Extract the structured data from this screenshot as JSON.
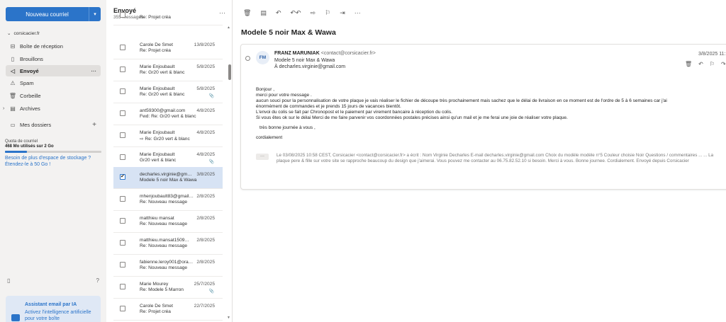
{
  "sidebar": {
    "new_mail_label": "Nouveau courriel",
    "account": "corsicacier.fr",
    "folders": [
      {
        "label": "Boîte de réception",
        "icon": "inbox-icon"
      },
      {
        "label": "Brouillons",
        "icon": "draft-icon"
      },
      {
        "label": "Envoyé",
        "icon": "send-icon",
        "active": true
      },
      {
        "label": "Spam",
        "icon": "spam-icon"
      },
      {
        "label": "Corbeille",
        "icon": "trash-icon"
      },
      {
        "label": "Archives",
        "icon": "archive-icon"
      }
    ],
    "my_folders": "Mes dossiers",
    "quota": {
      "title": "Quota de courriel",
      "used": "468 Mo utilisés sur 2 Go",
      "used_fraction": 0.23,
      "need_more": "Besoin de plus d'espace de stockage ? Étendez-le à 50 Go !"
    },
    "assistant": {
      "title": "Assistant email par IA",
      "desc": "Activez l'intelligence artificielle pour votre boîte"
    }
  },
  "list": {
    "title": "Envoyé",
    "count": "355 messages",
    "items": [
      {
        "from": "",
        "date": "",
        "subject": "Re: Projet créa",
        "selected": false,
        "attachment": false
      },
      {
        "from": "Carole De Smet",
        "date": "13/8/2025",
        "subject": "Re: Projet créa",
        "selected": false,
        "attachment": false
      },
      {
        "from": "Marie Enjoubault",
        "date": "5/8/2025",
        "subject": "Re: Gr20 vert & blanc",
        "selected": false,
        "attachment": false
      },
      {
        "from": "Marie Enjoubault",
        "date": "5/8/2025",
        "subject": "Re: Gr20 vert & blanc",
        "selected": false,
        "attachment": true
      },
      {
        "from": "ant59300@gmail.com",
        "date": "4/8/2025",
        "subject": "Fwd: Re: Gr20 vert & blanc",
        "selected": false,
        "attachment": false
      },
      {
        "from": "Marie Enjoubault",
        "date": "4/8/2025",
        "subject": "⇨ Re: Gr20 vert & blanc",
        "selected": false,
        "attachment": false
      },
      {
        "from": "Marie Enjoubault",
        "date": "4/8/2025",
        "subject": "Gr20 vert & blanc",
        "selected": false,
        "attachment": true
      },
      {
        "from": "decharles.virginie@gmail.com",
        "date": "3/8/2025",
        "subject": "Modele 5 noir Max & Wawa",
        "selected": true,
        "attachment": false
      },
      {
        "from": "mhenjoubault83@gmail.com",
        "date": "2/8/2025",
        "subject": "Re: Nouveau message",
        "selected": false,
        "attachment": false
      },
      {
        "from": "matthieu mansat",
        "date": "2/8/2025",
        "subject": "Re: Nouveau message",
        "selected": false,
        "attachment": false
      },
      {
        "from": "matthieu.mansat1509@gmail.com",
        "date": "2/8/2025",
        "subject": "Re: Nouveau message",
        "selected": false,
        "attachment": false
      },
      {
        "from": "fabienne.leroy001@orange.fr",
        "date": "2/8/2025",
        "subject": "Re: Nouveau message",
        "selected": false,
        "attachment": false
      },
      {
        "from": "Marie Mourey",
        "date": "25/7/2025",
        "subject": "Re: Modele 5 Marron",
        "selected": false,
        "attachment": true
      },
      {
        "from": "Carole De Smet",
        "date": "22/7/2025",
        "subject": "Re: Projet créa",
        "selected": false,
        "attachment": false
      }
    ]
  },
  "reading": {
    "subject": "Modele 5 noir Max & Wawa",
    "sender_name": "FRANZ MARUNIAK",
    "sender_email": "<contact@corsicacier.fr>",
    "avatar": "FM",
    "msg_subject": "Modele 5 noir Max & Wawa",
    "to_prefix": "À",
    "to": "decharles.virginie@gmail.com",
    "date": "3/8/2025 11:",
    "body": [
      "Bonjour ,",
      "merci pour votre message .",
      "aucun souci pour la personnalisation de votre plaque je vais réaliser le fichier de découpe très prochainement mais sachez que le délai de livraison en ce moment est de l'ordre de 5 à 6 semaines car j'ai",
      "énormément de commandes et je prends 15 jours de vacances bientôt.",
      "L'envoi du colis se fait par Chronopost et le paiement par virement bancaire à réception du colis.",
      "Si vous êtes ok sur le délai Merci de me faire parvenir vos coordonnées postales précises ainsi qu'un mail et je me ferai une joie de réaliser votre plaque.",
      "très bonne journée à vous ,",
      "cordialement"
    ],
    "quote_dots": "···",
    "quote": "Le 03/08/2025 10:58 CEST, Corsicacier <contact@corsicacier.fr> a écrit : Nom Virginie Decharles E-mail decharles.virginie@gmail.com Choix du modèle modèle n°5 Couleur choisie Noir Questions / commentaires ... ... La plaque pere & fille sur votre site se rapproche beaucoup du design que j'aimerai. Vous pouvez me contacter au 06.75.82.52.10 si besoin. Merci à vous. Bonne journee. Cordialement. Envoyé depuis Corsicacier"
  }
}
